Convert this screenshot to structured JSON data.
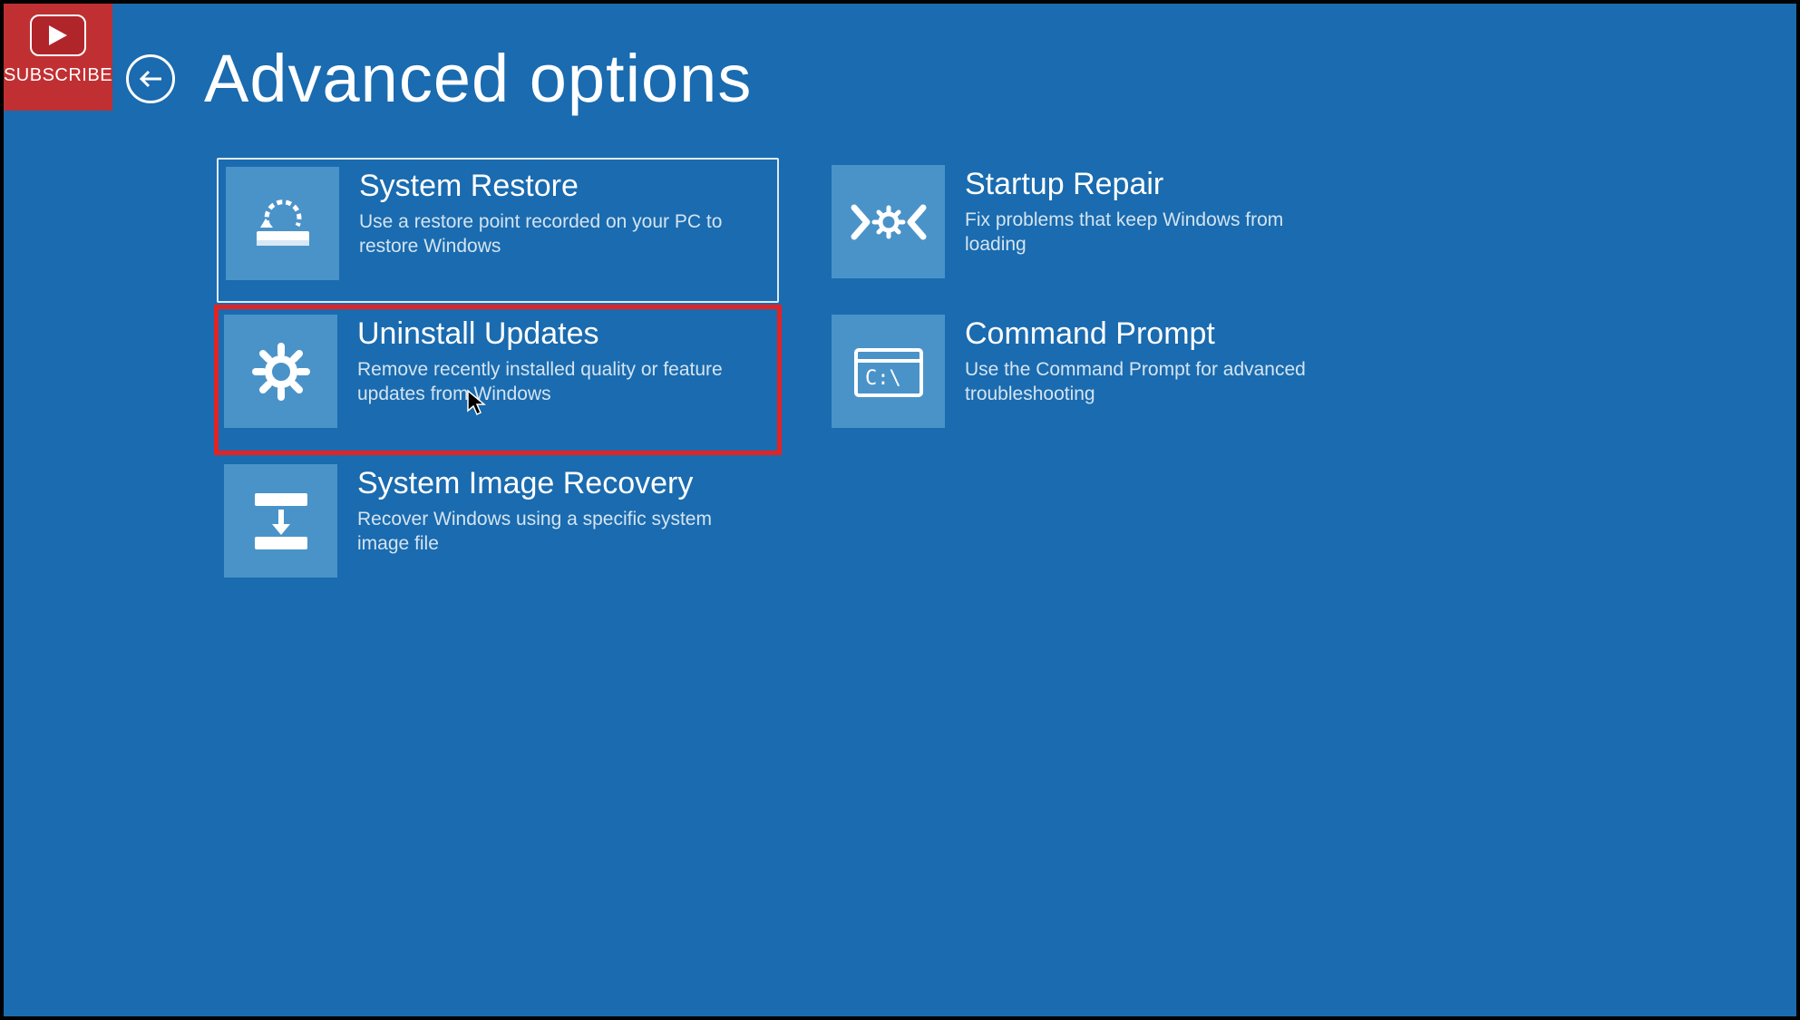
{
  "subscribe": {
    "label": "SUBSCRIBE"
  },
  "header": {
    "title": "Advanced options"
  },
  "tiles": {
    "system_restore": {
      "title": "System Restore",
      "desc": "Use a restore point recorded on your PC to restore Windows"
    },
    "startup_repair": {
      "title": "Startup Repair",
      "desc": "Fix problems that keep Windows from loading"
    },
    "uninstall_updates": {
      "title": "Uninstall Updates",
      "desc": "Remove recently installed quality or feature updates from Windows"
    },
    "command_prompt": {
      "title": "Command Prompt",
      "desc": "Use the Command Prompt for advanced troubleshooting"
    },
    "system_image_recovery": {
      "title": "System Image Recovery",
      "desc": "Recover Windows using a specific system image file"
    }
  },
  "colors": {
    "bg": "#1a6baf",
    "tile": "#4a93c9",
    "highlight": "#e52222",
    "subscribe": "#c03033"
  }
}
